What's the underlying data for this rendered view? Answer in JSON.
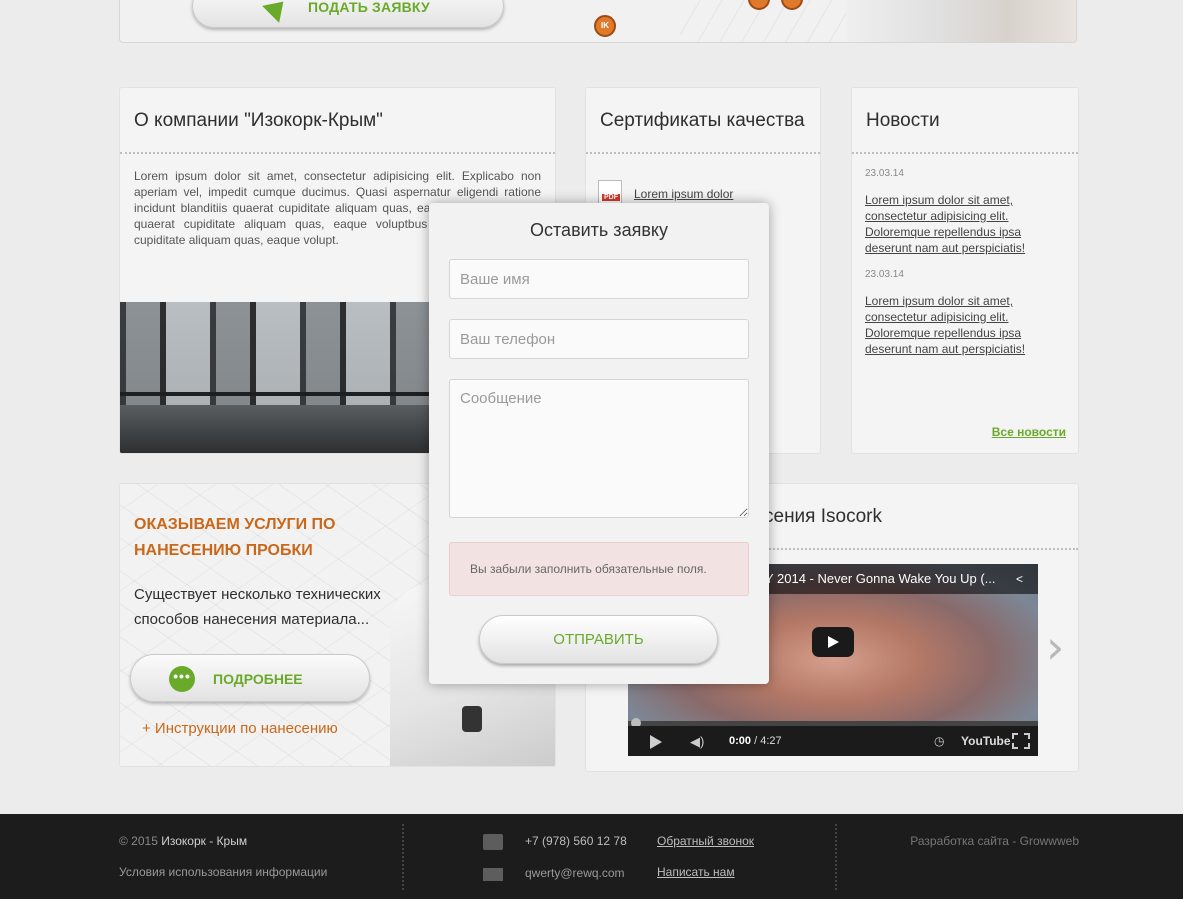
{
  "hero": {
    "apply_label": "ПОДАТЬ ЗАЯВКУ",
    "marker_label": "IK"
  },
  "about": {
    "title": "О компании \"Изокорк-Крым\"",
    "text": "Lorem ipsum dolor sit amet, consectetur adipisicing elit. Explicabo non aperiam vel, impedit cumque ducimus. Quasi aspernatur eligendi ratione incidunt blanditiis quaerat cupiditate aliquam quas, eaque voluptbus sequi quaerat cupiditate aliquam quas, eaque voluptbus sequi itlis quaerat cupiditate aliquam quas, eaque volupt."
  },
  "certificates": {
    "title": "Сертификаты качества",
    "items": [
      {
        "label": "Lorem ipsum dolor",
        "icon": "pdf-icon"
      }
    ]
  },
  "news": {
    "title": "Новости",
    "items": [
      {
        "date": "23.03.14",
        "text": "Lorem ipsum dolor sit amet, consectetur adipisicing elit. Doloremque repellendus ipsa deserunt nam aut perspiciatis!"
      },
      {
        "date": "23.03.14",
        "text": "Lorem ipsum dolor sit amet, consectetur adipisicing elit. Doloremque repellendus ipsa deserunt nam aut perspiciatis!"
      }
    ],
    "all_label": "Все новости"
  },
  "services": {
    "title": "ОКАЗЫВАЕМ УСЛУГИ ПО НАНЕСЕНИЮ ПРОБКИ",
    "subtitle": "Существует несколько технических способов нанесения материала...",
    "more_label": "ПОДРОБНЕЕ",
    "more_icon": "•••",
    "instructions_label": "+ Инструкции по нанесению"
  },
  "video_panel": {
    "title": "сения Isocork",
    "video_title": "Y 2014 - Never Gonna Wake You Up (...",
    "time_current": "0:00",
    "time_total": " / 4:27",
    "youtube_label": "YouTube"
  },
  "modal": {
    "title": "Оставить заявку",
    "name_placeholder": "Ваше имя",
    "phone_placeholder": "Ваш телефон",
    "message_placeholder": "Сообщение",
    "error": "Вы забыли заполнить обязательные поля.",
    "submit_label": "ОТПРАВИТЬ"
  },
  "footer": {
    "copyright_prefix": "© 2015 ",
    "company": "Изокорк - Крым",
    "terms": "Условия использования информации",
    "phone": "+7 (978) 560 12 78",
    "email": "qwerty@rewq.com",
    "callback": "Обратный звонок",
    "write_us": "Написать нам",
    "developer": "Разработка сайта - Growwweb"
  },
  "colors": {
    "accent_green": "#6aaa2a",
    "accent_orange": "#c9681a",
    "footer_bg": "#1c1c1c"
  }
}
